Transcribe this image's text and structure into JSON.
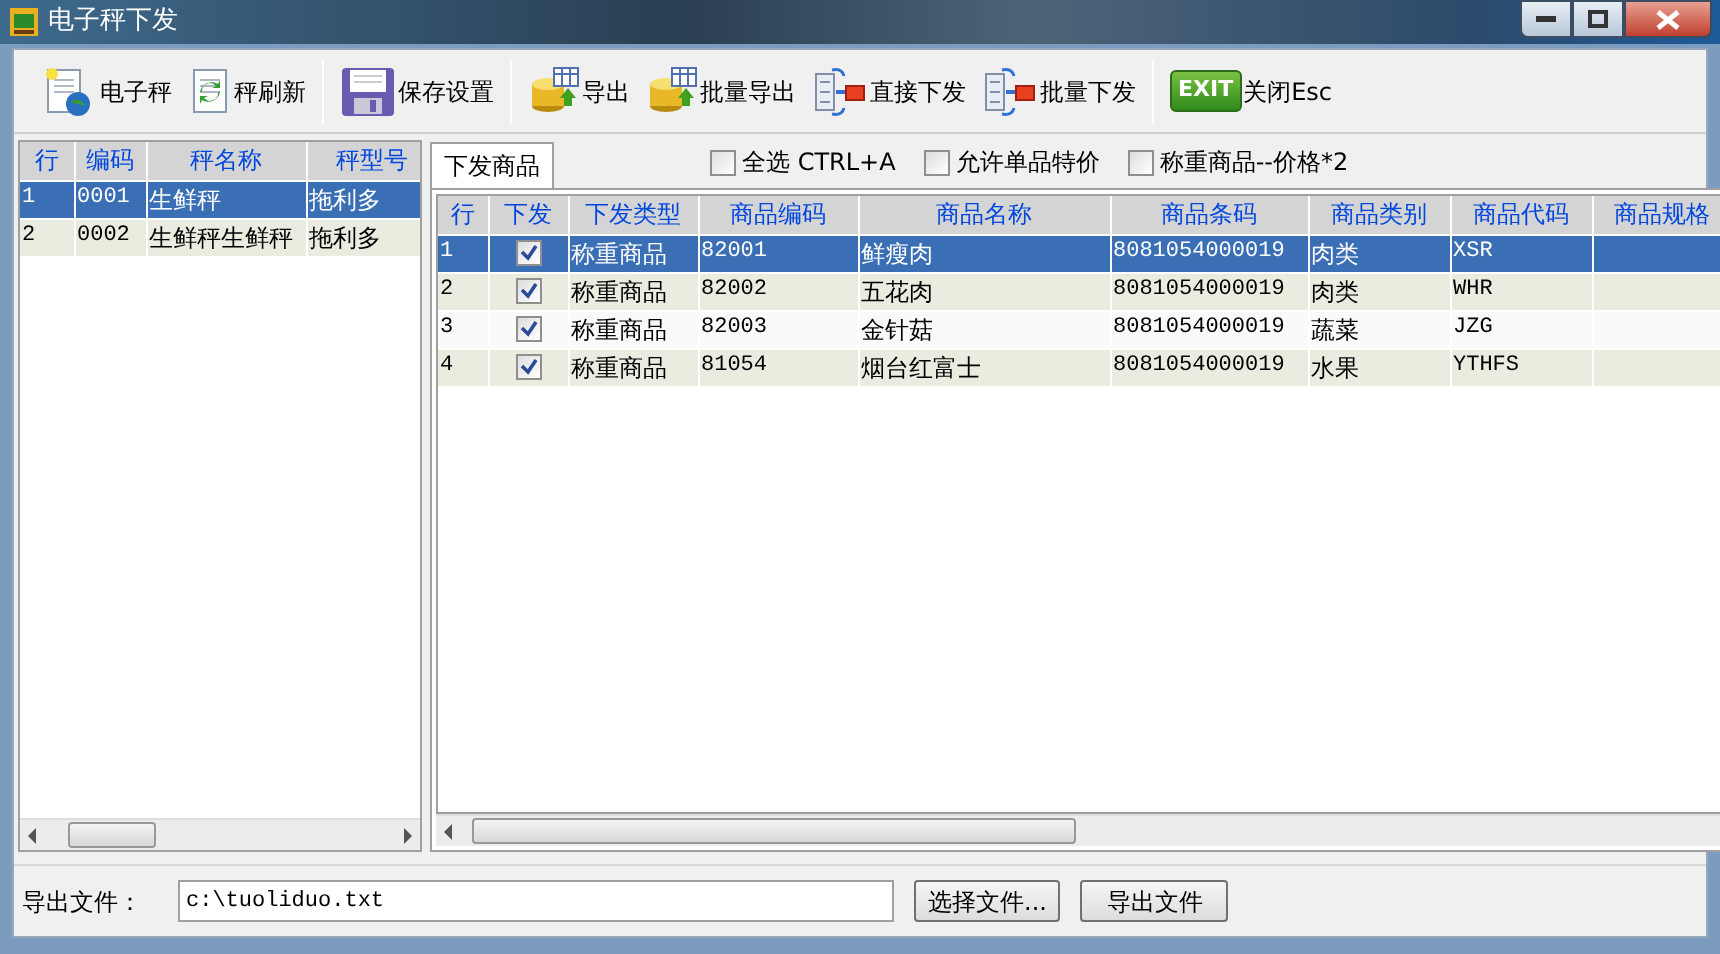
{
  "window": {
    "title": "电子秤下发"
  },
  "toolbar": [
    [
      {
        "kind": "new-scale",
        "label": "电子秤"
      },
      {
        "kind": "refresh",
        "label": "秤刷新"
      }
    ],
    [
      {
        "kind": "save",
        "label": "保存设置"
      }
    ],
    [
      {
        "kind": "export",
        "label": "导出"
      },
      {
        "kind": "batch-export",
        "label": "批量导出"
      },
      {
        "kind": "send",
        "label": "直接下发"
      },
      {
        "kind": "batch-send",
        "label": "批量下发"
      }
    ],
    [
      {
        "kind": "exit",
        "label": "关闭Esc",
        "badge": "EXIT"
      }
    ]
  ],
  "scales_table": {
    "columns": [
      "行",
      "编码",
      "秤名称",
      "秤型号"
    ],
    "rows": [
      {
        "selected": true,
        "cells": [
          "1",
          "0001",
          "生鲜秤",
          "拖利多"
        ]
      },
      {
        "selected": false,
        "cells": [
          "2",
          "0002",
          "生鲜秤生鲜秤",
          "拖利多"
        ]
      }
    ]
  },
  "tabs": [
    {
      "label": "下发商品",
      "selected": true
    }
  ],
  "options": [
    {
      "label": "全选 CTRL+A",
      "checked": false
    },
    {
      "label": "允许单品特价",
      "checked": false
    },
    {
      "label": "称重商品--价格*2",
      "checked": false
    }
  ],
  "goods_table": {
    "columns": [
      "行",
      "下发",
      "下发类型",
      "商品编码",
      "商品名称",
      "商品条码",
      "商品类别",
      "商品代码",
      "商品规格"
    ],
    "rows": [
      {
        "selected": true,
        "send": true,
        "cells": [
          "1",
          "",
          "称重商品",
          "82001",
          "鲜瘦肉",
          "8081054000019",
          "肉类",
          "XSR",
          ""
        ]
      },
      {
        "selected": false,
        "send": true,
        "cells": [
          "2",
          "",
          "称重商品",
          "82002",
          "五花肉",
          "8081054000019",
          "肉类",
          "WHR",
          ""
        ]
      },
      {
        "selected": false,
        "send": true,
        "cells": [
          "3",
          "",
          "称重商品",
          "82003",
          "金针菇",
          "8081054000019",
          "蔬菜",
          "JZG",
          ""
        ]
      },
      {
        "selected": false,
        "send": true,
        "cells": [
          "4",
          "",
          "称重商品",
          "81054",
          "烟台红富士",
          "8081054000019",
          "水果",
          "YTHFS",
          ""
        ]
      }
    ]
  },
  "export_file": {
    "label": "导出文件：",
    "value": "c:\\tuoliduo.txt",
    "buttons": [
      "选择文件...",
      "导出文件"
    ]
  }
}
